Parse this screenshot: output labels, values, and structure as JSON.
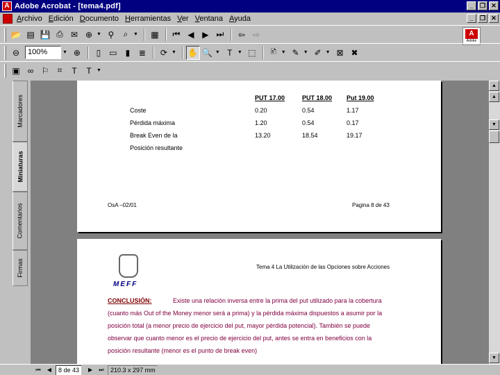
{
  "window": {
    "title": "Adobe Acrobat - [tema4.pdf]"
  },
  "menu": [
    "Archivo",
    "Edición",
    "Documento",
    "Herramientas",
    "Ver",
    "Ventana",
    "Ayuda"
  ],
  "toolbar": {
    "zoom": "100%",
    "logo_text": "Adobe"
  },
  "side_tabs": [
    "Marcadores",
    "Miniaturas",
    "Comentarios",
    "Firmas"
  ],
  "page1": {
    "headers": [
      "PUT 17.00",
      "PUT 18.00",
      "Put 19.00"
    ],
    "rows": [
      {
        "label": "Coste",
        "v1": "0.20",
        "v2": "0.54",
        "v3": "1.17"
      },
      {
        "label": "Pérdida máxima",
        "v1": "1.20",
        "v2": "0.54",
        "v3": "0.17"
      },
      {
        "label": "Break Even de la",
        "v1": "13.20",
        "v2": "18.54",
        "v3": "19.17"
      },
      {
        "label": "Posición resultante",
        "v1": "",
        "v2": "",
        "v3": ""
      }
    ],
    "footer_left": "OsA –02/01",
    "footer_right": "Pagina 8 de 43"
  },
  "page2": {
    "logo": "MEFF",
    "header": "Tema 4  La Utilización de las Opciones sobre Acciones",
    "conclusion_label": "CONCLUSIÓN:",
    "lines": [
      "Existe una relación inversa entre la prima del put utilizado para la cobertura",
      "(cuanto más Out of the Money  menor será  a prima) y la pérdida máxima dispuestos a asumir por la",
      "posición total (a menor precio de ejercicio del put, mayor pérdida potencial). También se puede",
      "observar que cuanto menor es el  precio de ejercicio del  put,  antes se entra en beneficios  con la",
      "posición resultante (menor es el punto de break even)"
    ]
  },
  "status": {
    "page": "8 de 43",
    "size": "210.3 x 297 mm"
  }
}
